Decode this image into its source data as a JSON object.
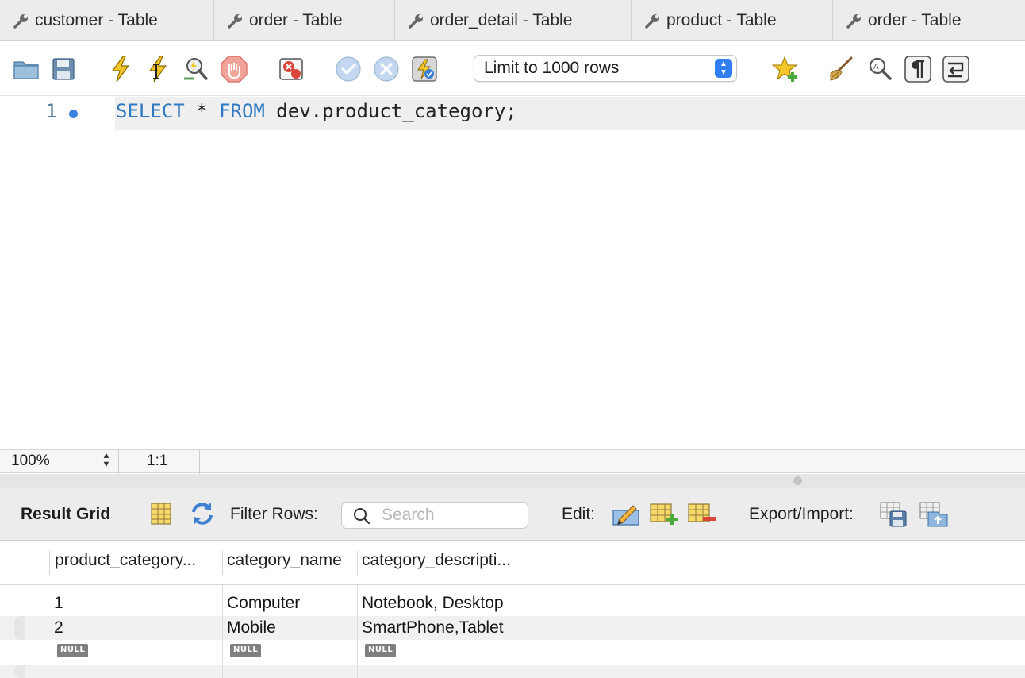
{
  "tabs": [
    {
      "label": "customer - Table"
    },
    {
      "label": "order - Table"
    },
    {
      "label": "order_detail - Table"
    },
    {
      "label": "product - Table"
    },
    {
      "label": "order - Table"
    }
  ],
  "toolbar": {
    "limit_select": "Limit to 1000 rows",
    "icons": [
      "open-folder-icon",
      "save-icon",
      "execute-icon",
      "execute-current-icon",
      "explain-icon",
      "stop-icon",
      "stop-on-error-icon",
      "commit-icon",
      "rollback-icon",
      "autocommit-icon",
      "add-snippet-icon",
      "beautify-icon",
      "find-icon",
      "invisible-chars-icon",
      "wrap-lines-icon"
    ]
  },
  "editor": {
    "line_number": "1",
    "code_keyword_1": "SELECT",
    "code_star": " * ",
    "code_keyword_2": "FROM",
    "code_rest": " dev.product_category;"
  },
  "status": {
    "zoom": "100%",
    "cursor_position": "1:1"
  },
  "result_toolbar": {
    "title": "Result Grid",
    "filter_label": "Filter Rows:",
    "search_placeholder": "Search",
    "edit_label": "Edit:",
    "export_label": "Export/Import:"
  },
  "grid": {
    "columns": [
      "product_category...",
      "category_name",
      "category_descripti..."
    ],
    "rows": [
      [
        "1",
        "Computer",
        "Notebook, Desktop"
      ],
      [
        "2",
        "Mobile",
        "SmartPhone,Tablet"
      ],
      [
        "NULL",
        "NULL",
        "NULL"
      ]
    ]
  },
  "colors": {
    "keyword": "#2f7ac0",
    "accent": "#2f7ff3",
    "null_badge": "#7f7f7f"
  }
}
